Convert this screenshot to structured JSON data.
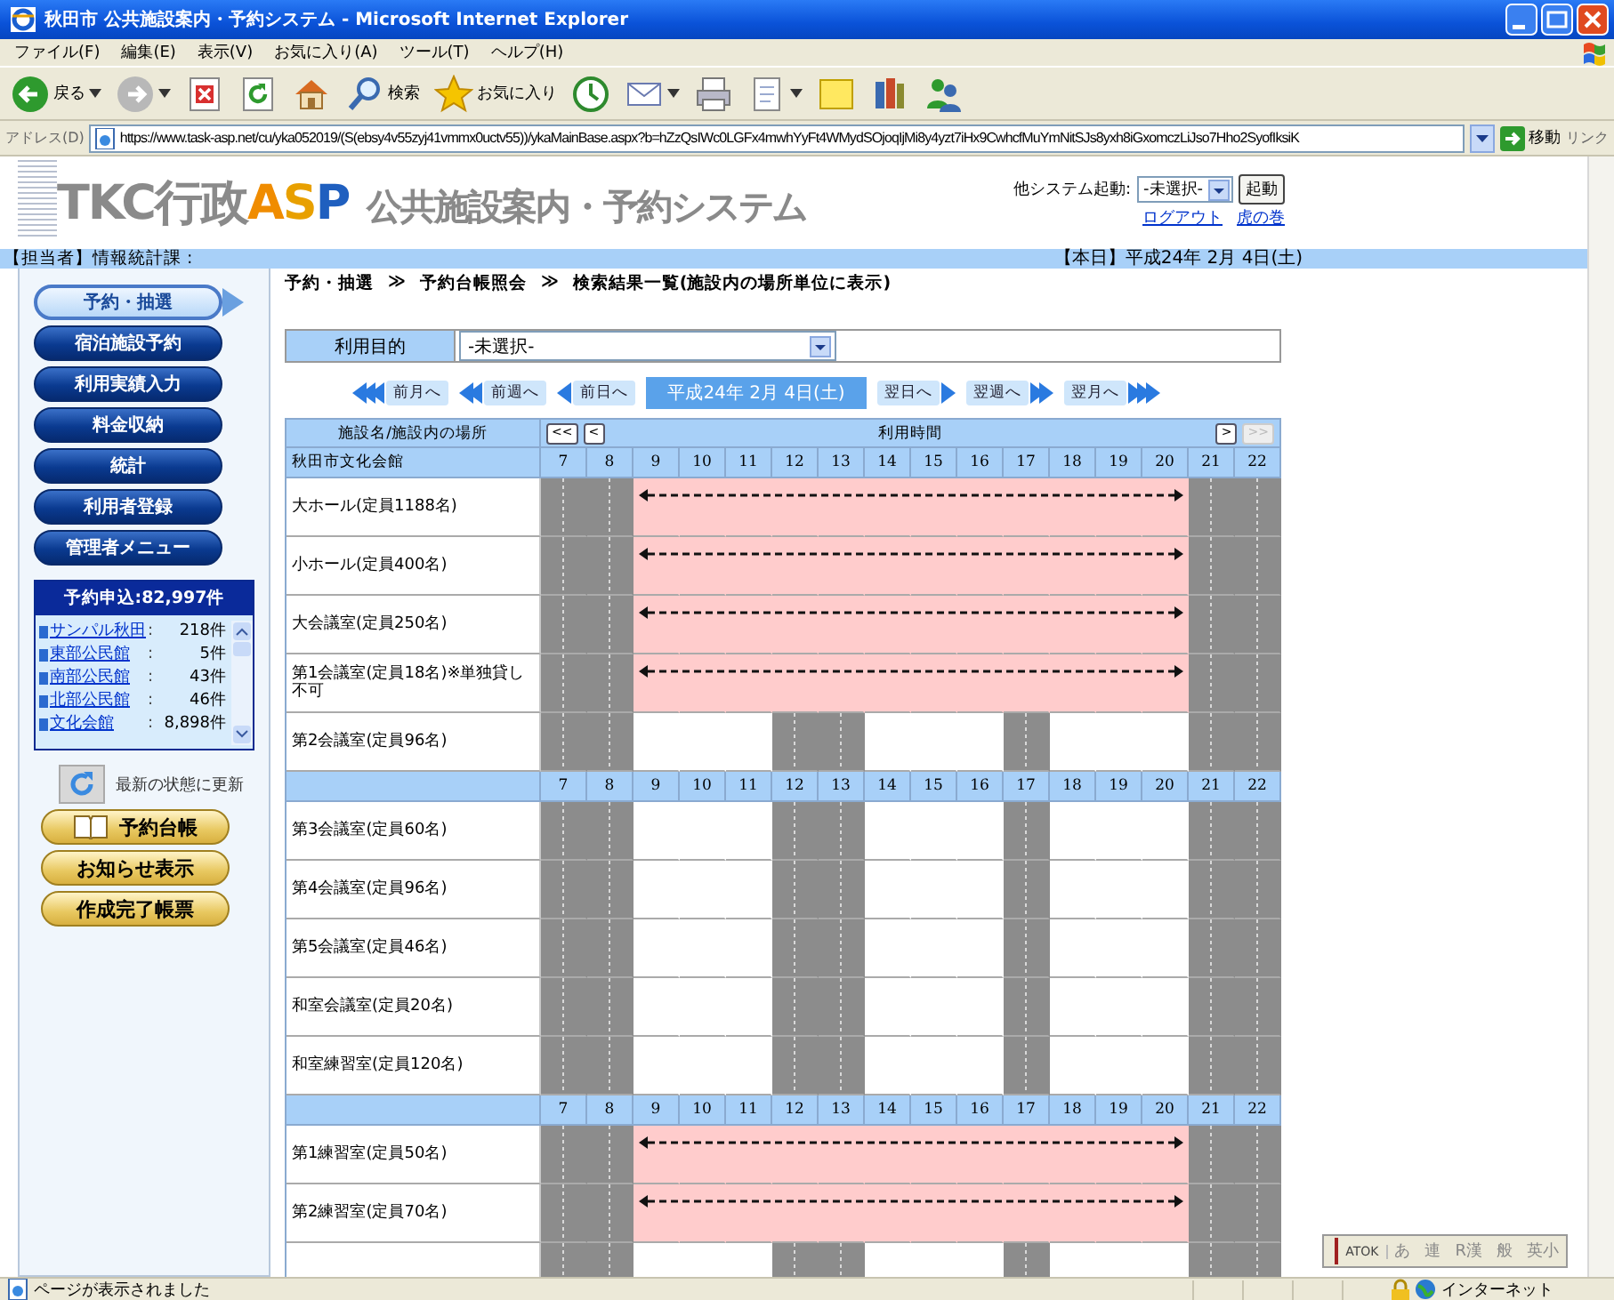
{
  "window": {
    "title": "秋田市 公共施設案内・予約システム - Microsoft Internet Explorer"
  },
  "menu": [
    "ファイル(F)",
    "編集(E)",
    "表示(V)",
    "お気に入り(A)",
    "ツール(T)",
    "ヘルプ(H)"
  ],
  "toolbar": [
    {
      "kind": "back",
      "label": "戻る",
      "dropdown": true
    },
    {
      "kind": "forward",
      "dropdown": true
    },
    {
      "kind": "stop",
      "dropdown": false
    },
    {
      "kind": "refresh",
      "dropdown": false
    },
    {
      "kind": "home",
      "dropdown": false
    },
    {
      "kind": "search",
      "label": "検索",
      "dropdown": false
    },
    {
      "kind": "favorites",
      "label": "お気に入り",
      "dropdown": false
    },
    {
      "kind": "history",
      "dropdown": false
    },
    {
      "kind": "mail",
      "dropdown": true
    },
    {
      "kind": "print",
      "dropdown": false
    },
    {
      "kind": "edit",
      "dropdown": true
    },
    {
      "kind": "note",
      "dropdown": false
    },
    {
      "kind": "research",
      "dropdown": false
    },
    {
      "kind": "messenger",
      "dropdown": false
    }
  ],
  "address": {
    "label": "アドレス(D)",
    "url": "https://www.task-asp.net/cu/yka052019/(S(ebsy4v55zyj41vmmx0uctv55))/ykaMainBase.aspx?b=hZzQsIWc0LGFx4mwhYyFt4WMydSOjoqIjMi8y4yzt7iHx9CwhcfMuYmNitSJs8yxh8iGxomczLiJso7Hho2SyofIksiK",
    "go": "移動",
    "links": "リンク"
  },
  "header": {
    "logo": [
      {
        "text": "TKC行政",
        "color": "#8a8a8a"
      },
      {
        "text": "A",
        "color": "#f08c00"
      },
      {
        "text": "S",
        "color": "#e8a000"
      },
      {
        "text": "P",
        "color": "#1f5fbf"
      },
      {
        "text": "公共施設案内・予約システム",
        "color": "#8a8a8a"
      }
    ],
    "launcher": {
      "label": "他システム起動:",
      "value": "-未選択-",
      "button": "起動"
    },
    "links": [
      "ログアウト",
      "虎の巻"
    ]
  },
  "info_bar": {
    "staff": "【担当者】情報統計課 :",
    "today": "【本日】平成24年 2月 4日(土)"
  },
  "sidebar": {
    "buttons": [
      {
        "label": "予約・抽選",
        "selected": true
      },
      {
        "label": "宿泊施設予約",
        "selected": false
      },
      {
        "label": "利用実績入力",
        "selected": false
      },
      {
        "label": "料金収納",
        "selected": false
      },
      {
        "label": "統計",
        "selected": false
      },
      {
        "label": "利用者登録",
        "selected": false
      },
      {
        "label": "管理者メニュー",
        "selected": false
      }
    ],
    "summary": {
      "title": "予約申込:82,997件",
      "items": [
        {
          "name": "サンパル秋田",
          "sep": ":",
          "count": "218件"
        },
        {
          "name": "東部公民館",
          "sep": ":",
          "count": "5件"
        },
        {
          "name": "南部公民館",
          "sep": ":",
          "count": "43件"
        },
        {
          "name": "北部公民館",
          "sep": ":",
          "count": "46件"
        },
        {
          "name": "文化会館",
          "sep": ":",
          "count": "8,898件"
        }
      ]
    },
    "refresh": "最新の状態に更新",
    "actions": [
      {
        "label": "予約台帳",
        "kind": "book"
      },
      {
        "label": "お知らせ表示",
        "kind": "plain"
      },
      {
        "label": "作成完了帳票",
        "kind": "plain"
      }
    ]
  },
  "breadcrumb": [
    "予約・抽選",
    "≫",
    "予約台帳照会",
    "≫",
    "検索結果一覧(施設内の場所単位に表示)"
  ],
  "purpose": {
    "label": "利用目的",
    "value": "-未選択-"
  },
  "date_nav": [
    {
      "kind": "back-month",
      "label": "前月へ"
    },
    {
      "kind": "back-week",
      "label": "前週へ"
    },
    {
      "kind": "back-day",
      "label": "前日へ"
    },
    {
      "kind": "current",
      "label": "平成24年 2月 4日(土)"
    },
    {
      "kind": "fwd-day",
      "label": "翌日へ"
    },
    {
      "kind": "fwd-week",
      "label": "翌週へ"
    },
    {
      "kind": "fwd-month",
      "label": "翌月へ"
    }
  ],
  "grid": {
    "header": {
      "name": "施設名/施設内の場所",
      "title": "利用時間",
      "prev": [
        {
          "label": "<<",
          "disabled": false
        },
        {
          "label": "<",
          "disabled": false
        }
      ],
      "next": [
        {
          "label": ">",
          "disabled": false
        },
        {
          "label": ">>",
          "disabled": true
        }
      ]
    },
    "rows": [
      {
        "kind": "hours",
        "name": "秋田市文化会館",
        "hours": [
          "7",
          "8",
          "9",
          "10",
          "11",
          "12",
          "13",
          "14",
          "15",
          "16",
          "17",
          "18",
          "19",
          "20",
          "21",
          "22"
        ]
      },
      {
        "kind": "facility",
        "name": "大ホール(定員1188名)",
        "slots": [
          {
            "kind": "closed"
          },
          {
            "kind": "closed"
          },
          {
            "kind": "booked"
          },
          {
            "kind": "booked"
          },
          {
            "kind": "booked"
          },
          {
            "kind": "booked"
          },
          {
            "kind": "booked"
          },
          {
            "kind": "booked"
          },
          {
            "kind": "booked"
          },
          {
            "kind": "booked"
          },
          {
            "kind": "booked"
          },
          {
            "kind": "booked"
          },
          {
            "kind": "booked"
          },
          {
            "kind": "booked"
          },
          {
            "kind": "closed"
          },
          {
            "kind": "closed"
          }
        ]
      },
      {
        "kind": "facility",
        "name": "小ホール(定員400名)",
        "slots": [
          {
            "kind": "closed"
          },
          {
            "kind": "closed"
          },
          {
            "kind": "booked"
          },
          {
            "kind": "booked"
          },
          {
            "kind": "booked"
          },
          {
            "kind": "booked"
          },
          {
            "kind": "booked"
          },
          {
            "kind": "booked"
          },
          {
            "kind": "booked"
          },
          {
            "kind": "booked"
          },
          {
            "kind": "booked"
          },
          {
            "kind": "booked"
          },
          {
            "kind": "booked"
          },
          {
            "kind": "booked"
          },
          {
            "kind": "closed"
          },
          {
            "kind": "closed"
          }
        ]
      },
      {
        "kind": "facility",
        "name": "大会議室(定員250名)",
        "slots": [
          {
            "kind": "closed"
          },
          {
            "kind": "closed"
          },
          {
            "kind": "booked"
          },
          {
            "kind": "booked"
          },
          {
            "kind": "booked"
          },
          {
            "kind": "booked"
          },
          {
            "kind": "booked"
          },
          {
            "kind": "booked"
          },
          {
            "kind": "booked"
          },
          {
            "kind": "booked"
          },
          {
            "kind": "booked"
          },
          {
            "kind": "booked"
          },
          {
            "kind": "booked"
          },
          {
            "kind": "booked"
          },
          {
            "kind": "closed"
          },
          {
            "kind": "closed"
          }
        ]
      },
      {
        "kind": "facility",
        "name": "第1会議室(定員18名)※単独貸し不可",
        "slots": [
          {
            "kind": "closed"
          },
          {
            "kind": "closed"
          },
          {
            "kind": "booked"
          },
          {
            "kind": "booked"
          },
          {
            "kind": "booked"
          },
          {
            "kind": "booked"
          },
          {
            "kind": "booked"
          },
          {
            "kind": "booked"
          },
          {
            "kind": "booked"
          },
          {
            "kind": "booked"
          },
          {
            "kind": "booked"
          },
          {
            "kind": "booked"
          },
          {
            "kind": "booked"
          },
          {
            "kind": "booked"
          },
          {
            "kind": "closed"
          },
          {
            "kind": "closed"
          }
        ]
      },
      {
        "kind": "facility",
        "name": "第2会議室(定員96名)",
        "slots": [
          {
            "kind": "closed"
          },
          {
            "kind": "closed"
          },
          {
            "kind": "free"
          },
          {
            "kind": "free"
          },
          {
            "kind": "free"
          },
          {
            "kind": "closed"
          },
          {
            "kind": "closed"
          },
          {
            "kind": "free"
          },
          {
            "kind": "free"
          },
          {
            "kind": "free"
          },
          {
            "kind": "closed"
          },
          {
            "kind": "free"
          },
          {
            "kind": "free"
          },
          {
            "kind": "free"
          },
          {
            "kind": "closed"
          },
          {
            "kind": "closed"
          }
        ]
      },
      {
        "kind": "hours",
        "hours": [
          "7",
          "8",
          "9",
          "10",
          "11",
          "12",
          "13",
          "14",
          "15",
          "16",
          "17",
          "18",
          "19",
          "20",
          "21",
          "22"
        ]
      },
      {
        "kind": "facility",
        "name": "第3会議室(定員60名)",
        "slots": [
          {
            "kind": "closed"
          },
          {
            "kind": "closed"
          },
          {
            "kind": "free"
          },
          {
            "kind": "free"
          },
          {
            "kind": "free"
          },
          {
            "kind": "closed"
          },
          {
            "kind": "closed"
          },
          {
            "kind": "free"
          },
          {
            "kind": "free"
          },
          {
            "kind": "free"
          },
          {
            "kind": "closed"
          },
          {
            "kind": "free"
          },
          {
            "kind": "free"
          },
          {
            "kind": "free"
          },
          {
            "kind": "closed"
          },
          {
            "kind": "closed"
          }
        ]
      },
      {
        "kind": "facility",
        "name": "第4会議室(定員96名)",
        "slots": [
          {
            "kind": "closed"
          },
          {
            "kind": "closed"
          },
          {
            "kind": "free"
          },
          {
            "kind": "free"
          },
          {
            "kind": "free"
          },
          {
            "kind": "closed"
          },
          {
            "kind": "closed"
          },
          {
            "kind": "free"
          },
          {
            "kind": "free"
          },
          {
            "kind": "free"
          },
          {
            "kind": "closed"
          },
          {
            "kind": "free"
          },
          {
            "kind": "free"
          },
          {
            "kind": "free"
          },
          {
            "kind": "closed"
          },
          {
            "kind": "closed"
          }
        ]
      },
      {
        "kind": "facility",
        "name": "第5会議室(定員46名)",
        "slots": [
          {
            "kind": "closed"
          },
          {
            "kind": "closed"
          },
          {
            "kind": "free"
          },
          {
            "kind": "free"
          },
          {
            "kind": "free"
          },
          {
            "kind": "closed"
          },
          {
            "kind": "closed"
          },
          {
            "kind": "free"
          },
          {
            "kind": "free"
          },
          {
            "kind": "free"
          },
          {
            "kind": "closed"
          },
          {
            "kind": "free"
          },
          {
            "kind": "free"
          },
          {
            "kind": "free"
          },
          {
            "kind": "closed"
          },
          {
            "kind": "closed"
          }
        ]
      },
      {
        "kind": "facility",
        "name": "和室会議室(定員20名)",
        "slots": [
          {
            "kind": "closed"
          },
          {
            "kind": "closed"
          },
          {
            "kind": "free"
          },
          {
            "kind": "free"
          },
          {
            "kind": "free"
          },
          {
            "kind": "closed"
          },
          {
            "kind": "closed"
          },
          {
            "kind": "free"
          },
          {
            "kind": "free"
          },
          {
            "kind": "free"
          },
          {
            "kind": "closed"
          },
          {
            "kind": "free"
          },
          {
            "kind": "free"
          },
          {
            "kind": "free"
          },
          {
            "kind": "closed"
          },
          {
            "kind": "closed"
          }
        ]
      },
      {
        "kind": "facility",
        "name": "和室練習室(定員120名)",
        "slots": [
          {
            "kind": "closed"
          },
          {
            "kind": "closed"
          },
          {
            "kind": "free"
          },
          {
            "kind": "free"
          },
          {
            "kind": "free"
          },
          {
            "kind": "closed"
          },
          {
            "kind": "closed"
          },
          {
            "kind": "free"
          },
          {
            "kind": "free"
          },
          {
            "kind": "free"
          },
          {
            "kind": "closed"
          },
          {
            "kind": "free"
          },
          {
            "kind": "free"
          },
          {
            "kind": "free"
          },
          {
            "kind": "closed"
          },
          {
            "kind": "closed"
          }
        ]
      },
      {
        "kind": "hours",
        "hours": [
          "7",
          "8",
          "9",
          "10",
          "11",
          "12",
          "13",
          "14",
          "15",
          "16",
          "17",
          "18",
          "19",
          "20",
          "21",
          "22"
        ]
      },
      {
        "kind": "facility",
        "name": "第1練習室(定員50名)",
        "slots": [
          {
            "kind": "closed"
          },
          {
            "kind": "closed"
          },
          {
            "kind": "booked"
          },
          {
            "kind": "booked"
          },
          {
            "kind": "booked"
          },
          {
            "kind": "booked"
          },
          {
            "kind": "booked"
          },
          {
            "kind": "booked"
          },
          {
            "kind": "booked"
          },
          {
            "kind": "booked"
          },
          {
            "kind": "booked"
          },
          {
            "kind": "booked"
          },
          {
            "kind": "booked"
          },
          {
            "kind": "booked"
          },
          {
            "kind": "closed"
          },
          {
            "kind": "closed"
          }
        ]
      },
      {
        "kind": "facility",
        "name": "第2練習室(定員70名)",
        "slots": [
          {
            "kind": "closed"
          },
          {
            "kind": "closed"
          },
          {
            "kind": "booked"
          },
          {
            "kind": "booked"
          },
          {
            "kind": "booked"
          },
          {
            "kind": "booked"
          },
          {
            "kind": "booked"
          },
          {
            "kind": "booked"
          },
          {
            "kind": "booked"
          },
          {
            "kind": "booked"
          },
          {
            "kind": "booked"
          },
          {
            "kind": "booked"
          },
          {
            "kind": "booked"
          },
          {
            "kind": "booked"
          },
          {
            "kind": "closed"
          },
          {
            "kind": "closed"
          }
        ]
      },
      {
        "kind": "facility",
        "slots": [
          {
            "kind": "closed"
          },
          {
            "kind": "closed"
          },
          {
            "kind": "free"
          },
          {
            "kind": "free"
          },
          {
            "kind": "free"
          },
          {
            "kind": "closed"
          },
          {
            "kind": "closed"
          },
          {
            "kind": "free"
          },
          {
            "kind": "free"
          },
          {
            "kind": "free"
          },
          {
            "kind": "closed"
          },
          {
            "kind": "free"
          },
          {
            "kind": "free"
          },
          {
            "kind": "free"
          },
          {
            "kind": "closed"
          },
          {
            "kind": "closed"
          }
        ]
      }
    ]
  },
  "ime_bar": [
    "ATOK",
    "あ",
    "連",
    "R漢",
    "般",
    "英小"
  ],
  "status_bar": {
    "text": "ページが表示されました",
    "zone": "インターネット"
  }
}
